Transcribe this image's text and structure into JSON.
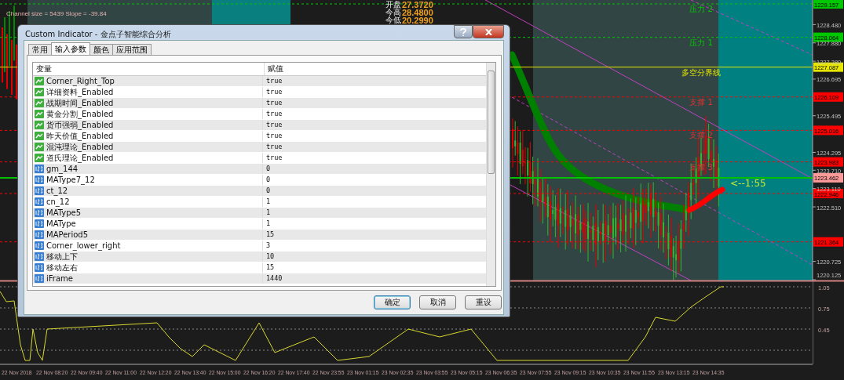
{
  "chart": {
    "info_text": "Channel size = 5439 Slope = -39.84",
    "daily_stats": [
      {
        "label": "开盘",
        "value": "27.3720"
      },
      {
        "label": "今高",
        "value": "28.4800"
      },
      {
        "label": "今低",
        "value": "20.2990"
      }
    ],
    "levels": [
      {
        "label": "压力 2",
        "price": "1229.157",
        "color": "#00c800",
        "kind": "dashed"
      },
      {
        "label": "压力 1",
        "price": "1228.064",
        "color": "#00c800",
        "kind": "dashed"
      },
      {
        "label": "多空分界线",
        "price": "1227.087",
        "color": "#e6e600",
        "kind": "solid"
      },
      {
        "label": "支撑 1",
        "price": "1226.109",
        "color": "#ff0000",
        "kind": "dashed"
      },
      {
        "label": "支撑 2",
        "price": "1225.016",
        "color": "#ff0000",
        "kind": "dashed"
      },
      {
        "label": "支撑 3",
        "price": "1223.983",
        "color": "#ff0000",
        "kind": "dashed"
      },
      {
        "price": "1223.462",
        "color": "#ff9a9a",
        "kind": "current"
      },
      {
        "price": "1222.946",
        "color": "#ff0000",
        "kind": "dashed"
      },
      {
        "price": "1221.364",
        "color": "#ff0000",
        "kind": "dashed"
      }
    ],
    "price_scale": [
      "1228.480",
      "1227.880",
      "1227.280",
      "1226.695",
      "1225.495",
      "1224.295",
      "1223.710",
      "1223.110",
      "1222.510",
      "1220.725",
      "1220.125"
    ],
    "countdown": "<--1:55",
    "indicator_scale": [
      "1.05",
      "0.75",
      "0.45"
    ],
    "time_axis": [
      "22 Nov 2018",
      "22 Nov 08:20",
      "22 Nov 09:40",
      "22 Nov 11:00",
      "22 Nov 12:20",
      "22 Nov 13:40",
      "22 Nov 15:00",
      "22 Nov 16:20",
      "22 Nov 17:40",
      "22 Nov 23:55",
      "23 Nov 01:15",
      "23 Nov 02:35",
      "23 Nov 03:55",
      "23 Nov 05:15",
      "23 Nov 06:35",
      "23 Nov 07:55",
      "23 Nov 09:15",
      "23 Nov 10:35",
      "23 Nov 11:55",
      "23 Nov 13:15",
      "23 Nov 14:35"
    ]
  },
  "dialog": {
    "title": "Custom Indicator - 金点子智能综合分析",
    "tabs": [
      {
        "label": "常用",
        "selected": false
      },
      {
        "label": "输入参数",
        "selected": true
      },
      {
        "label": "颜色",
        "selected": false
      },
      {
        "label": "应用范围",
        "selected": false
      }
    ],
    "table": {
      "columns": [
        "变量",
        "赋值"
      ],
      "rows": [
        {
          "kind": "bool",
          "name": "Corner_Right_Top",
          "value": "true"
        },
        {
          "kind": "bool",
          "name": "详细资料_Enabled",
          "value": "true"
        },
        {
          "kind": "bool",
          "name": "战期时间_Enabled",
          "value": "true"
        },
        {
          "kind": "bool",
          "name": "黄金分割_Enabled",
          "value": "true"
        },
        {
          "kind": "bool",
          "name": "货币强弱_Enabled",
          "value": "true"
        },
        {
          "kind": "bool",
          "name": "昨天价值_Enabled",
          "value": "true"
        },
        {
          "kind": "bool",
          "name": "混沌理论_Enabled",
          "value": "true"
        },
        {
          "kind": "bool",
          "name": "道氏理论_Enabled",
          "value": "true"
        },
        {
          "kind": "int",
          "name": "gm_144",
          "value": "0"
        },
        {
          "kind": "int",
          "name": "MAType7_12",
          "value": "0"
        },
        {
          "kind": "int",
          "name": "ct_12",
          "value": "0"
        },
        {
          "kind": "int",
          "name": "cn_12",
          "value": "1"
        },
        {
          "kind": "int",
          "name": "MAType5",
          "value": "1"
        },
        {
          "kind": "int",
          "name": "MAType",
          "value": "1"
        },
        {
          "kind": "int",
          "name": "MAPeriod5",
          "value": "15"
        },
        {
          "kind": "int",
          "name": "Corner_lower_right",
          "value": "3"
        },
        {
          "kind": "int",
          "name": "移动上下",
          "value": "10"
        },
        {
          "kind": "int",
          "name": "移动左右",
          "value": "15"
        },
        {
          "kind": "int",
          "name": "iFrame",
          "value": "1440"
        }
      ]
    },
    "buttons": [
      {
        "label": "确定",
        "default": true
      },
      {
        "label": "取消",
        "default": false
      },
      {
        "label": "重设",
        "default": false
      }
    ]
  }
}
